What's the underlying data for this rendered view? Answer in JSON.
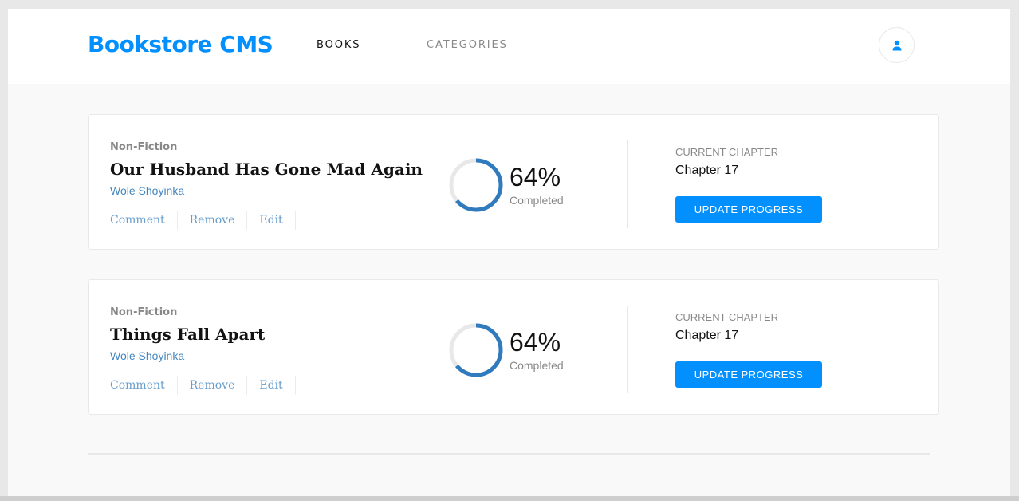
{
  "app": {
    "brand": "Bookstore CMS"
  },
  "nav": {
    "books": "BOOKS",
    "categories": "CATEGORIES",
    "user_icon": "user-icon"
  },
  "colors": {
    "accent": "#0290ff",
    "author": "#4386bf",
    "text": "#121212",
    "muted": "#888888"
  },
  "books": [
    {
      "genre": "Non-Fiction",
      "title": "Our Husband Has Gone Mad Again",
      "author": "Wole Shoyinka",
      "actions": [
        "Comment",
        "Remove",
        "Edit"
      ],
      "progress_percent": 64,
      "percent_label": "64%",
      "completed_label": "Completed",
      "chapter_label": "CURRENT CHAPTER",
      "chapter": "Chapter 17",
      "update_label": "UPDATE PROGRESS"
    },
    {
      "genre": "Non-Fiction",
      "title": "Things Fall Apart",
      "author": "Wole Shoyinka",
      "actions": [
        "Comment",
        "Remove",
        "Edit"
      ],
      "progress_percent": 64,
      "percent_label": "64%",
      "completed_label": "Completed",
      "chapter_label": "CURRENT CHAPTER",
      "chapter": "Chapter 17",
      "update_label": "UPDATE PROGRESS"
    }
  ]
}
